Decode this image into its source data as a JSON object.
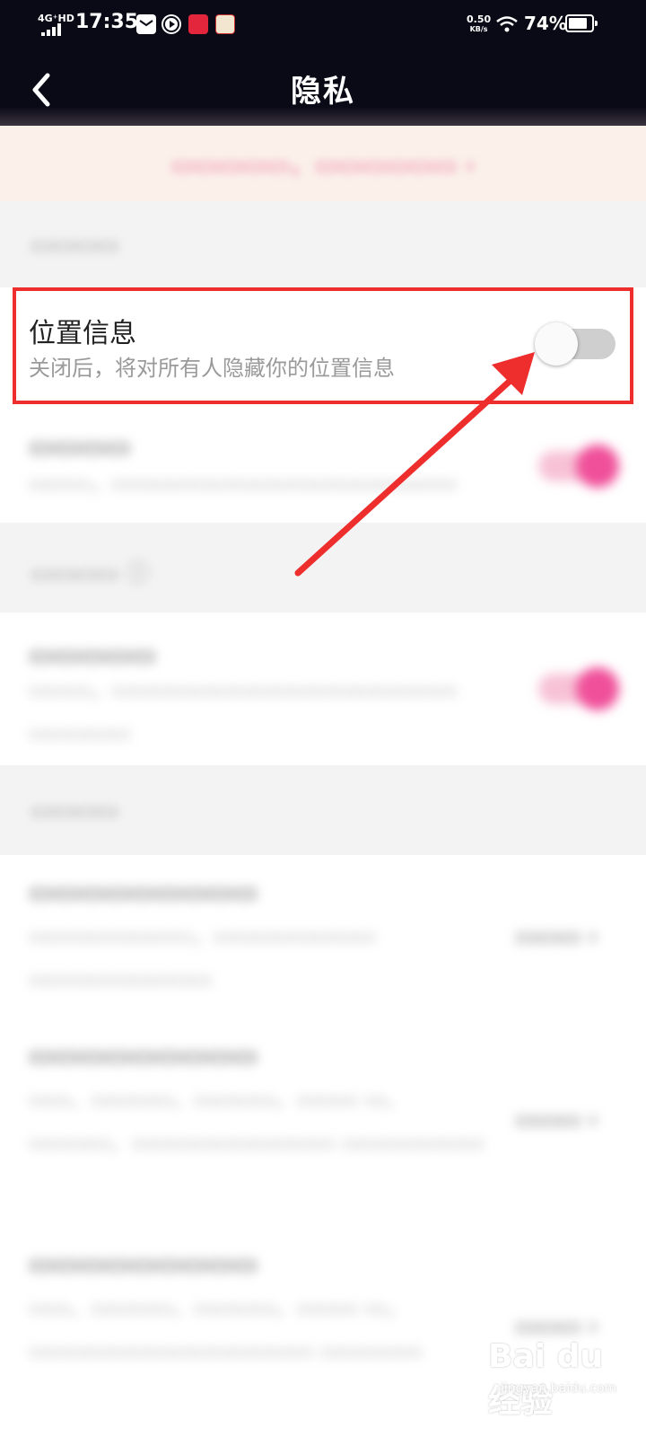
{
  "status_bar": {
    "signal": "4G⁺HD",
    "time": "17:35",
    "net_speed_value": "0.50",
    "net_speed_unit": "KB/s",
    "battery_percent": "74%"
  },
  "header": {
    "title": "隐私"
  },
  "settings": {
    "location": {
      "title": "位置信息",
      "subtitle": "关闭后，将对所有人隐藏你的位置信息",
      "enabled": false
    }
  },
  "watermark": {
    "brand": "Bai du 经验",
    "domain": "jingyan.baidu.com"
  },
  "colors": {
    "highlight_box": "#ee2d2d",
    "arrow": "#ee2d2d",
    "toggle_on": "#f0509a",
    "header_bg": "#0a0a16"
  }
}
